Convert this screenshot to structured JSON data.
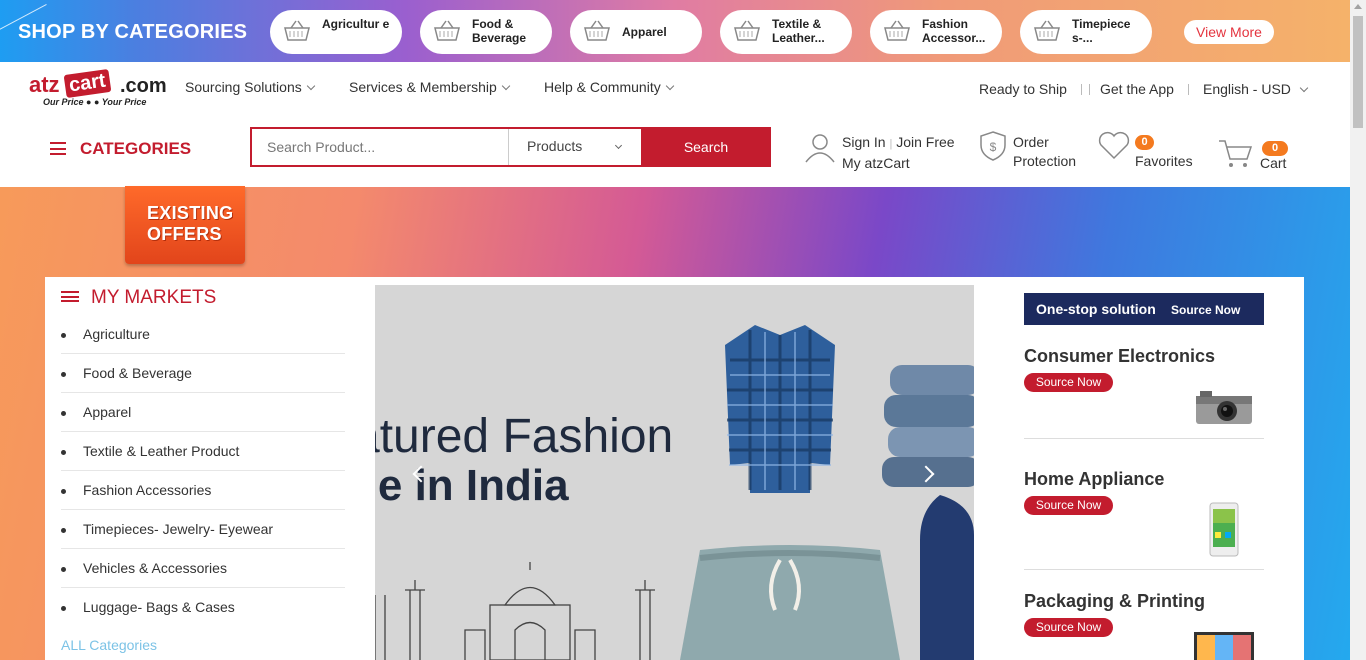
{
  "top_strip": {
    "title": "SHOP BY CATEGORIES",
    "pills": [
      {
        "label": "Agricultur e"
      },
      {
        "label": "Food & Beverage"
      },
      {
        "label": "Apparel"
      },
      {
        "label": "Textile & Leather..."
      },
      {
        "label": "Fashion Accessor..."
      },
      {
        "label": "Timepiece s-..."
      }
    ],
    "view_more": "View More"
  },
  "logo": {
    "brand_a": "atz",
    "brand_b": "cart",
    "brand_c": ".com",
    "tagline": "Our Price ● ● Your Price"
  },
  "nav": {
    "items": [
      {
        "label": "Sourcing Solutions"
      },
      {
        "label": "Services & Membership"
      },
      {
        "label": "Help & Community"
      }
    ],
    "ready_to_ship": "Ready to Ship",
    "get_app": "Get the App",
    "language": "English - USD"
  },
  "categories_label": "CATEGORIES",
  "search": {
    "placeholder": "Search Product...",
    "scope": "Products",
    "button": "Search"
  },
  "account": {
    "sign_in": "Sign In",
    "join": "Join Free",
    "my": "My atzCart"
  },
  "order_protection": {
    "line1": "Order",
    "line2": "Protection"
  },
  "favorites": {
    "label": "Favorites",
    "count": "0"
  },
  "cart": {
    "label": "Cart",
    "count": "0"
  },
  "offers": {
    "line1": "EXISTING",
    "line2": "OFFERS"
  },
  "markets": {
    "title": "MY MARKETS",
    "items": [
      "Agriculture",
      "Food & Beverage",
      "Apparel",
      "Textile & Leather Product",
      "Fashion Accessories",
      "Timepieces- Jewelry- Eyewear",
      "Vehicles & Accessories",
      "Luggage- Bags & Cases"
    ],
    "all": "ALL Categories"
  },
  "banner": {
    "line1": "atured Fashion",
    "line2": "de in India"
  },
  "one_stop": {
    "title": "One-stop solution",
    "cta": "Source Now"
  },
  "sectors": [
    {
      "title": "Consumer Electronics",
      "cta": "Source Now"
    },
    {
      "title": "Home Appliance",
      "cta": "Source Now"
    },
    {
      "title": "Packaging & Printing",
      "cta": "Source Now"
    }
  ],
  "colors": {
    "brand_red": "#c31c2e",
    "navy": "#1c2a5e",
    "badge_orange": "#f47a1f"
  }
}
